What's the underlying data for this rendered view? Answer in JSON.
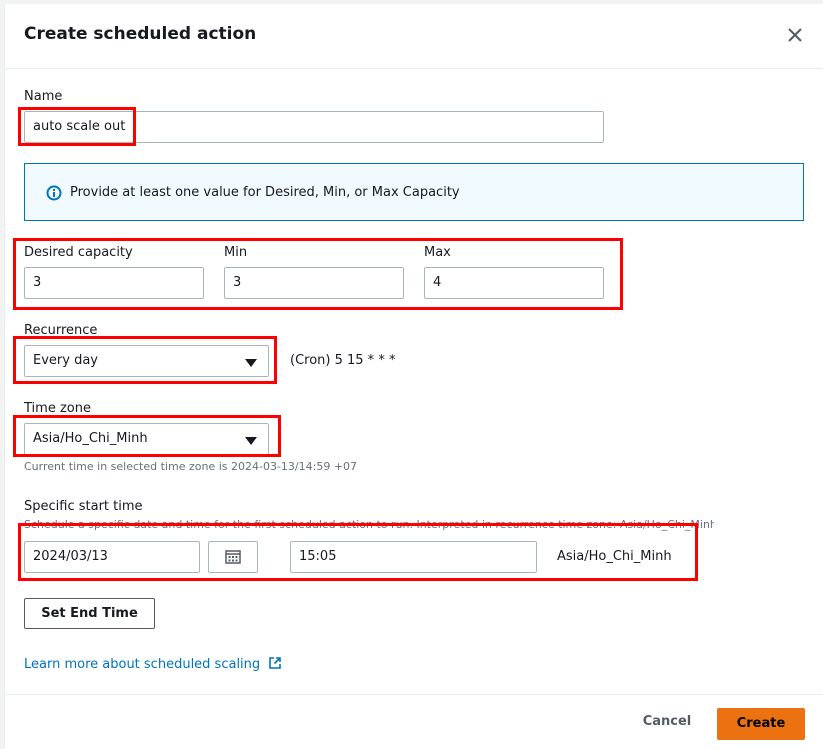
{
  "dialog": {
    "title": "Create scheduled action"
  },
  "form": {
    "name": {
      "label": "Name",
      "value": "auto scale out"
    },
    "info_message": "Provide at least one value for Desired, Min, or Max Capacity",
    "desired": {
      "label": "Desired capacity",
      "value": "3"
    },
    "min": {
      "label": "Min",
      "value": "3"
    },
    "max": {
      "label": "Max",
      "value": "4"
    },
    "recurrence": {
      "label": "Recurrence",
      "value": "Every day",
      "cron": "(Cron) 5 15 * * *"
    },
    "timezone": {
      "label": "Time zone",
      "value": "Asia/Ho_Chi_Minh",
      "hint": "Current time in selected time zone is 2024-03-13/14:59 +07"
    },
    "start_time": {
      "label": "Specific start time",
      "description": "Schedule a specific date and time for the first scheduled action to run. Interpreted in recurrence time zone: Asia/Ho_Chi_Minh",
      "date": "2024/03/13",
      "time": "15:05",
      "zone": "Asia/Ho_Chi_Minh"
    },
    "set_end_time_label": "Set End Time",
    "learn_more_label": "Learn more about scheduled scaling"
  },
  "footer": {
    "cancel_label": "Cancel",
    "create_label": "Create"
  },
  "colors": {
    "primary": "#ec7211",
    "link": "#0073bb",
    "info_bg": "#f1faff",
    "highlight": "#ff0000"
  }
}
